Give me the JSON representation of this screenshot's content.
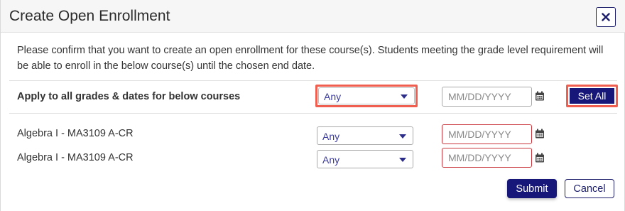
{
  "dialog": {
    "title": "Create Open Enrollment",
    "description": "Please confirm that you want to create an open enrollment for these course(s). Students meeting the grade level requirement will be able to enroll in the below course(s) until the chosen end date."
  },
  "apply_all": {
    "label": "Apply to all grades & dates for below courses",
    "grade_value": "Any",
    "date_placeholder": "MM/DD/YYYY",
    "set_all_label": "Set All"
  },
  "courses": [
    {
      "name": "Algebra I - MA3109 A-CR",
      "grade_value": "Any",
      "date_placeholder": "MM/DD/YYYY"
    },
    {
      "name": "Algebra I - MA3109 A-CR",
      "grade_value": "Any",
      "date_placeholder": "MM/DD/YYYY"
    }
  ],
  "footer": {
    "submit_label": "Submit",
    "cancel_label": "Cancel"
  },
  "icons": {
    "close": "close-icon",
    "calendar": "calendar-icon",
    "dropdown": "chevron-down-icon"
  },
  "colors": {
    "primary": "#17177a",
    "highlight": "#ef5e4e",
    "error_border": "#c9363b",
    "select_text": "#3b3ba0"
  }
}
